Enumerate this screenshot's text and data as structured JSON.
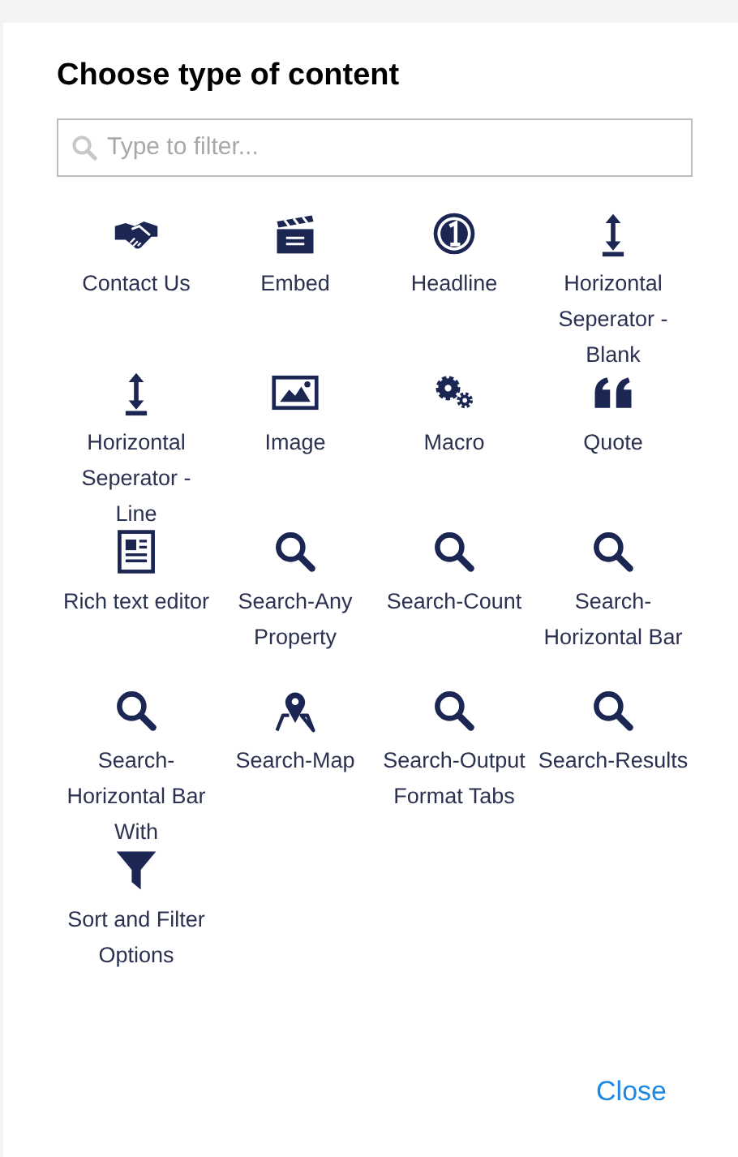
{
  "dialog": {
    "title": "Choose type of content",
    "search": {
      "placeholder": "Type to filter..."
    },
    "items": [
      {
        "label": "Contact Us"
      },
      {
        "label": "Embed"
      },
      {
        "label": "Headline"
      },
      {
        "label": "Horizontal Seperator - Blank"
      },
      {
        "label": "Horizontal Seperator - Line"
      },
      {
        "label": "Image"
      },
      {
        "label": "Macro"
      },
      {
        "label": "Quote"
      },
      {
        "label": "Rich text editor"
      },
      {
        "label": "Search-Any Property"
      },
      {
        "label": "Search-Count"
      },
      {
        "label": "Search-Horizontal Bar"
      },
      {
        "label": "Search-Horizontal Bar With"
      },
      {
        "label": "Search-Map"
      },
      {
        "label": "Search-Output Format Tabs"
      },
      {
        "label": "Search-Results"
      },
      {
        "label": "Sort and Filter Options"
      }
    ],
    "close": "Close"
  }
}
